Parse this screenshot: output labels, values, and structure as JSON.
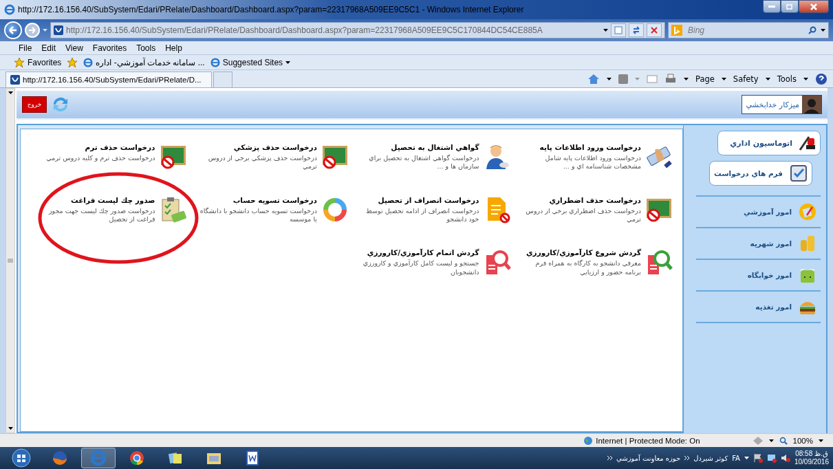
{
  "window": {
    "title": "http://172.16.156.40/SubSystem/Edari/PRelate/Dashboard/Dashboard.aspx?param=22317968A509EE9C5C1 - Windows Internet Explorer"
  },
  "address_bar": {
    "url": "http://172.16.156.40/SubSystem/Edari/PRelate/Dashboard/Dashboard.aspx?param=22317968A509EE9C5C170844DC54CE885A"
  },
  "search": {
    "placeholder": "Bing"
  },
  "menu": {
    "file": "File",
    "edit": "Edit",
    "view": "View",
    "favorites": "Favorites",
    "tools": "Tools",
    "help": "Help"
  },
  "favorites_bar": {
    "label": "Favorites",
    "site_link": "... سامانه خدمات آموزشي- اداره",
    "suggested_sites": "Suggested Sites"
  },
  "tabs": [
    {
      "label": "http://172.16.156.40/SubSystem/Edari/PRelate/D...",
      "selected": true
    }
  ],
  "command_bar": {
    "page": "Page",
    "safety": "Safety",
    "tools": "Tools"
  },
  "page": {
    "exit_button": "خروج",
    "user": {
      "name": "ميزكار خدابخشي"
    },
    "tiles": [
      {
        "kind": "keyboard",
        "title": "درخواست ورود اطلاعات پايه",
        "description": "درخواست ورود اطلاعات پايه شامل مشخصات شناسنامه اي و ...",
        "circled": false
      },
      {
        "kind": "employee",
        "title": "گواهي اشتغال به تحصيل",
        "description": "درخواست گواهي اشتغال به تحصيل براي سازمان ها و ...",
        "circled": false
      },
      {
        "kind": "chalkboard",
        "title": "درخواست حذف پزشكي",
        "description": "درخواست حذف پزشكي برخي از دروس ترمي",
        "circled": false
      },
      {
        "kind": "chalkboard",
        "title": "درخواست حذف ترم",
        "description": "درخواست حذف ترم و كليه دروس ترمي",
        "circled": false
      },
      {
        "kind": "chalkboard",
        "title": "درخواست حذف اضطراري",
        "description": "درخواست حذف اضطراري برخي از دروس ترمي",
        "circled": false
      },
      {
        "kind": "document",
        "title": "درخواست انصراف از تحصيل",
        "description": "درخواست انصراف از ادامه تحصيل توسط خود دانشجو",
        "circled": false
      },
      {
        "kind": "cycle",
        "title": "درخواست تسويه حساب",
        "description": "درخواست تسويه حساب دانشجو با دانشگاه يا موسسه",
        "circled": false
      },
      {
        "kind": "checklist",
        "title": "صدور چك ليست فراغت",
        "description": "درخواست صدور چك ليست جهت مجوز فراغت از تحصيل",
        "circled": true
      },
      {
        "kind": "magnifier",
        "color": "#3aa03a",
        "title": "گردش شروع كارآموزي/كارورزي",
        "description": "معرفي دانشجو به كارگاه به همراه فرم برنامه حضور و ارزيابي",
        "circled": false
      },
      {
        "kind": "magnifier",
        "color": "#e8434f",
        "title": "گردش اتمام كارآموزي/كارورزي",
        "description": "جستجو و ليست كامل كارآموزي و كارورزي دانشجويان",
        "circled": false
      }
    ],
    "sidebar": {
      "header": "اتوماسيون اداري",
      "items": [
        {
          "kind": "form",
          "label": "فرم هاي درخواست",
          "selected": true
        },
        {
          "kind": "education",
          "label": "امور آموزشي",
          "selected": false
        },
        {
          "kind": "coins",
          "label": "امور شهريه",
          "selected": false
        },
        {
          "kind": "dorm",
          "label": "امور خوابگاه",
          "selected": false
        },
        {
          "kind": "food",
          "label": "امور تغذيه",
          "selected": false
        }
      ]
    }
  },
  "status_bar": {
    "zone": "Internet | Protected Mode: On",
    "zoom": "100%"
  },
  "taskbar": {
    "toolbars": [
      "كوثر شيردل",
      "حوزه معاونت آموزشي"
    ],
    "language": "FA",
    "period": "ق.ظ",
    "time": "08:58",
    "date": "10/09/2016"
  }
}
